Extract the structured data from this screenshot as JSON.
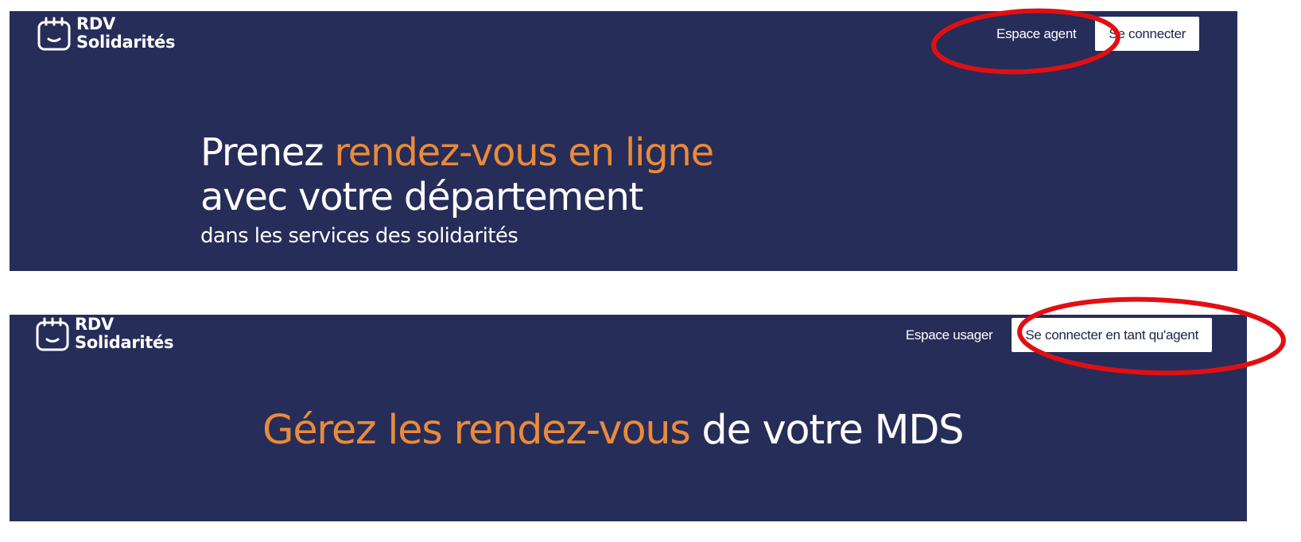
{
  "colors": {
    "panel_bg": "#262d59",
    "accent": "#ea8a3a",
    "text": "#ffffff",
    "annotation": "#e10f12"
  },
  "user_view": {
    "logo": {
      "icon": "calendar-smile-icon",
      "line1": "RDV",
      "line2": "Solidarités"
    },
    "nav": {
      "link": "Espace agent",
      "button": "Se connecter"
    },
    "hero": {
      "line1_plain": "Prenez ",
      "line1_accent": "rendez-vous en ligne",
      "line2": "avec votre département",
      "line3": "dans les services des solidarités"
    }
  },
  "agent_view": {
    "logo": {
      "icon": "calendar-smile-icon",
      "line1": "RDV",
      "line2": "Solidarités"
    },
    "nav": {
      "link": "Espace usager",
      "button": "Se connecter en tant qu'agent"
    },
    "hero": {
      "accent": "Gérez les rendez-vous",
      "plain": " de votre MDS"
    }
  }
}
